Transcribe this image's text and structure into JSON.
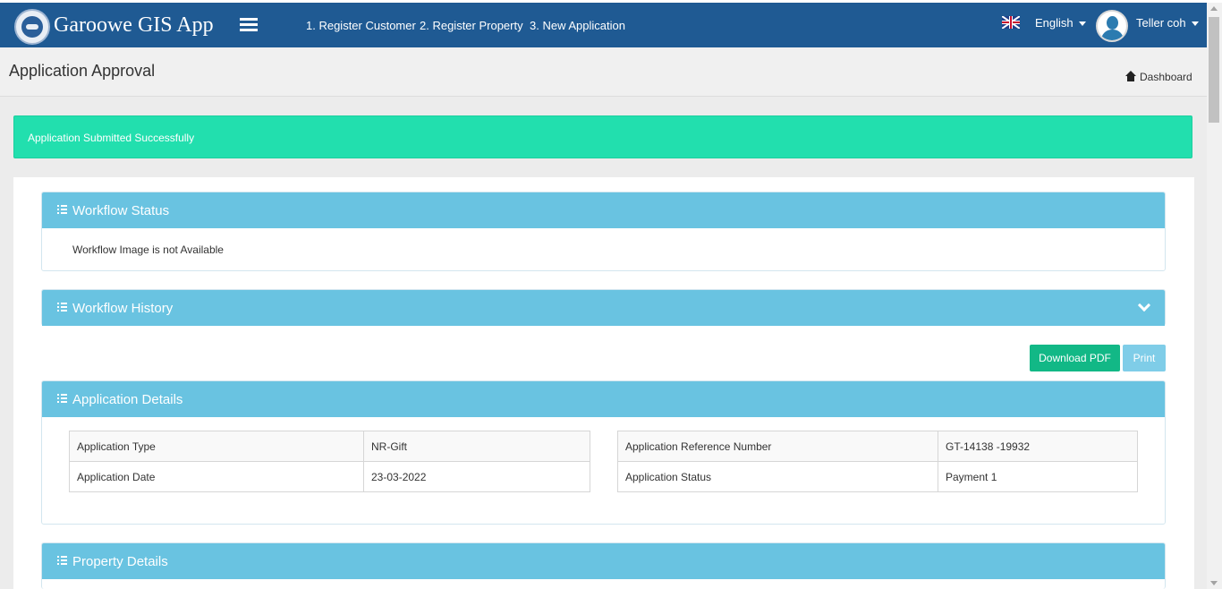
{
  "app": {
    "title": "Garoowe GIS App",
    "nav_links": [
      "1. Register Customer",
      "2. Register Property",
      "3. New Application"
    ],
    "language": "English",
    "user": "Teller coh",
    "brand_color": "#1f5a93"
  },
  "page": {
    "title": "Application Approval",
    "breadcrumb": "Dashboard"
  },
  "alert": {
    "message": "Application Submitted Successfully",
    "color": "#22dfae"
  },
  "workflow_status": {
    "title": "Workflow Status",
    "image_alt": "Workflow Image is not Available"
  },
  "workflow_history": {
    "title": "Workflow History"
  },
  "actions": {
    "download_pdf": "Download PDF",
    "print": "Print"
  },
  "application_details": {
    "title": "Application Details",
    "left": [
      {
        "label": "Application Type",
        "value": "NR-Gift"
      },
      {
        "label": "Application Date",
        "value": "23-03-2022"
      }
    ],
    "right": [
      {
        "label": "Application Reference Number",
        "value": "GT-14138 -19932"
      },
      {
        "label": "Application Status",
        "value": "Payment 1"
      }
    ]
  },
  "property_details": {
    "title": "Property Details"
  },
  "icons": [
    "logo-icon",
    "menu-icon",
    "uk-flag-icon",
    "user-avatar-icon",
    "home-icon",
    "list-icon",
    "chevron-down-icon"
  ]
}
